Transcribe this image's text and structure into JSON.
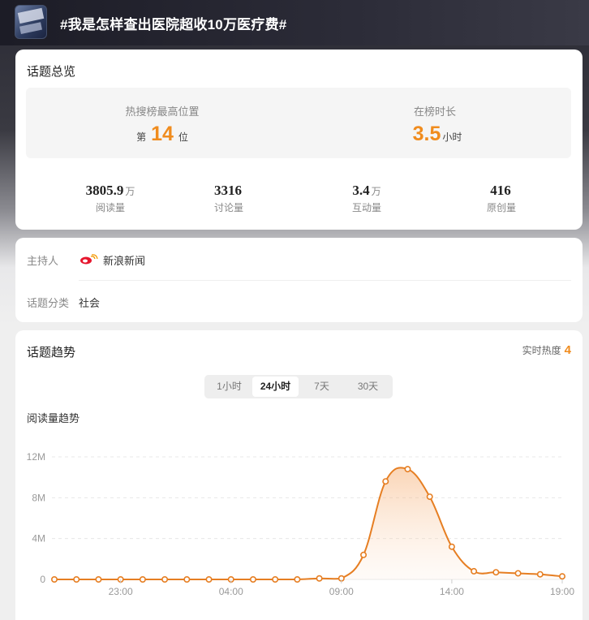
{
  "header": {
    "title": "#我是怎样查出医院超收10万医疗费#",
    "thumbnail_icon": "topic-thumbnail"
  },
  "overview": {
    "title": "话题总览",
    "rank": {
      "label": "热搜榜最高位置",
      "prefix": "第",
      "value": "14",
      "suffix": "位"
    },
    "duration": {
      "label": "在榜时长",
      "value": "3.5",
      "suffix": "小时"
    },
    "stats": [
      {
        "value": "3805.9",
        "unit": "万",
        "label": "阅读量"
      },
      {
        "value": "3316",
        "unit": "",
        "label": "讨论量"
      },
      {
        "value": "3.4",
        "unit": "万",
        "label": "互动量"
      },
      {
        "value": "416",
        "unit": "",
        "label": "原创量"
      }
    ]
  },
  "info": {
    "host_label": "主持人",
    "host_logo": "sina-logo-icon",
    "host_name": "新浪新闻",
    "category_label": "话题分类",
    "category": "社会"
  },
  "trend": {
    "title": "话题趋势",
    "heat_label": "实时热度",
    "heat_value": "4",
    "tabs": [
      "1小时",
      "24小时",
      "7天",
      "30天"
    ],
    "active_tab": "24小时",
    "subtitle": "阅读量趋势",
    "accent_color": "#e67e22"
  },
  "chart_data": {
    "type": "area",
    "title": "阅读量趋势",
    "ylim": [
      0,
      12
    ],
    "y_ticks": [
      "0",
      "4M",
      "8M",
      "12M"
    ],
    "y_tick_values": [
      0,
      4,
      8,
      12
    ],
    "x_tick_labels": [
      "23:00",
      "04:00",
      "09:00",
      "14:00",
      "19:00"
    ],
    "x_tick_indexes": [
      3,
      8,
      13,
      18,
      23
    ],
    "grid": true,
    "series": [
      {
        "values": [
          0.0,
          0.0,
          0.0,
          0.0,
          0.0,
          0.0,
          0.0,
          0.0,
          0.0,
          0.0,
          0.0,
          0.0,
          0.1,
          0.1,
          2.4,
          9.6,
          10.8,
          8.1,
          3.2,
          0.8,
          0.7,
          0.6,
          0.5,
          0.3
        ]
      }
    ]
  }
}
